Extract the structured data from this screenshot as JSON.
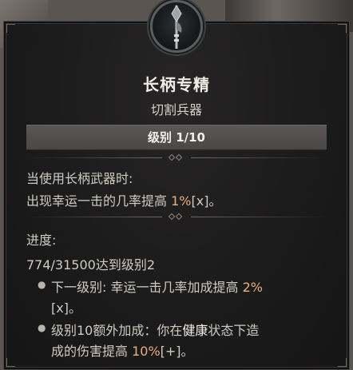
{
  "tooltip": {
    "title": "长柄专精",
    "subtitle": "切割兵器",
    "level": "级别 1/10",
    "condition": "当使用长柄武器时:",
    "effect_prefix": "出现幸运一击的几率提高 ",
    "effect_value": "1%",
    "effect_suffix": "[x]。",
    "progress_label": "进度:",
    "progress_text": "774/31500达到级别2",
    "next_level": {
      "prefix": "下一级别: 幸运一击几率加成提高 ",
      "value": "2%",
      "suffix": "[x]。"
    },
    "bonus": {
      "line1_prefix": "级别10额外加成：你在",
      "line1_keyword": "健康",
      "line1_suffix": "状态下造",
      "line2_prefix": "成的伤害提高 ",
      "line2_value": "10%",
      "line2_suffix": "[+]。"
    },
    "emblem_icon": "polearm-icon",
    "colors": {
      "highlight": "#e9b07c",
      "text": "#cfcbc4",
      "panel": "#1c1b1b"
    }
  }
}
